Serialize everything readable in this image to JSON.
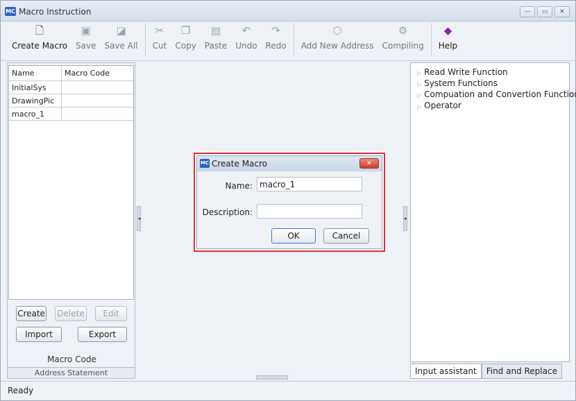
{
  "window": {
    "title": "Macro Instruction",
    "app_badge": "MC",
    "controls": {
      "minimize": "▭",
      "maximize": "▭",
      "close": "✕"
    }
  },
  "toolbar": {
    "items": [
      {
        "label": "Create Macro",
        "icon": "document-new-icon",
        "glyph": "🗋"
      },
      {
        "label": "Save",
        "icon": "save-icon",
        "glyph": "▣"
      },
      {
        "label": "Save All",
        "icon": "save-all-icon",
        "glyph": "◪"
      },
      {
        "label": "Cut",
        "icon": "cut-icon",
        "glyph": "✂"
      },
      {
        "label": "Copy",
        "icon": "copy-icon",
        "glyph": "❐"
      },
      {
        "label": "Paste",
        "icon": "paste-icon",
        "glyph": "▤"
      },
      {
        "label": "Undo",
        "icon": "undo-icon",
        "glyph": "↶"
      },
      {
        "label": "Redo",
        "icon": "redo-icon",
        "glyph": "↷"
      },
      {
        "label": "Add New Address",
        "icon": "add-address-icon",
        "glyph": "⬡"
      },
      {
        "label": "Compiling",
        "icon": "compile-icon",
        "glyph": "⚙"
      },
      {
        "label": "Help",
        "icon": "help-icon",
        "glyph": "◆"
      }
    ]
  },
  "macro_list": {
    "columns": [
      "Name",
      "Macro Code"
    ],
    "rows": [
      {
        "name": "InitialSys",
        "code": ""
      },
      {
        "name": "DrawingPic",
        "code": ""
      },
      {
        "name": "macro_1",
        "code": ""
      }
    ]
  },
  "left_buttons": {
    "create": "Create",
    "delete": "Delete",
    "edit": "Edit",
    "import": "Import",
    "export": "Export"
  },
  "left_footer": {
    "macro_code": "Macro Code",
    "address_statement": "Address Statement"
  },
  "function_tree": {
    "items": [
      "Read Write Function",
      "System Functions",
      "Compuation and Convertion Function",
      "Operator"
    ]
  },
  "right_tabs": {
    "input_assistant": "Input assistant",
    "find_replace": "Find and Replace"
  },
  "status": {
    "text": "Ready"
  },
  "dialog": {
    "title": "Create Macro",
    "badge": "MC",
    "close": "✕",
    "name_label": "Name:",
    "name_value": "macro_1",
    "description_label": "Description:",
    "description_value": "",
    "ok": "OK",
    "cancel": "Cancel",
    "highlight_color": "#e0313b"
  },
  "colors": {
    "accent": "#2b63c6",
    "highlight": "#e0313b"
  }
}
